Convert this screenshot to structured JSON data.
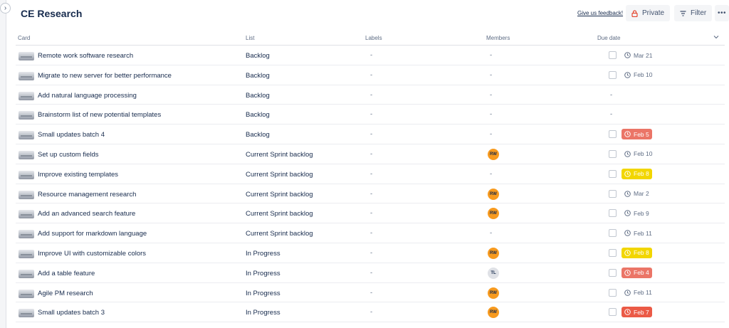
{
  "header": {
    "title": "CE Research",
    "feedback_link": "Give us feedback!",
    "private_label": "Private",
    "filter_label": "Filter",
    "more_label": "•••"
  },
  "columns": {
    "card": "Card",
    "list": "List",
    "labels": "Labels",
    "members": "Members",
    "due_date": "Due date"
  },
  "empty_value": "-",
  "colors": {
    "avatar_rw": "#f79a1f",
    "avatar_tl": "#dfe1e6",
    "due_red_light": "#eb7567",
    "due_yellow": "#f2d600",
    "due_red": "#eb5a46"
  },
  "rows": [
    {
      "card": "Remote work software research",
      "list": "Backlog",
      "labels": "-",
      "member": null,
      "has_checkbox": true,
      "due": "Mar 21",
      "due_status": "plain"
    },
    {
      "card": "Migrate to new server for better performance",
      "list": "Backlog",
      "labels": "-",
      "member": null,
      "has_checkbox": true,
      "due": "Feb 10",
      "due_status": "plain"
    },
    {
      "card": "Add natural language processing",
      "list": "Backlog",
      "labels": "-",
      "member": null,
      "has_checkbox": false,
      "due": null,
      "due_status": "none"
    },
    {
      "card": "Brainstorm list of new potential templates",
      "list": "Backlog",
      "labels": "-",
      "member": null,
      "has_checkbox": false,
      "due": null,
      "due_status": "none"
    },
    {
      "card": "Small updates batch 4",
      "list": "Backlog",
      "labels": "-",
      "member": null,
      "has_checkbox": true,
      "due": "Feb 5",
      "due_status": "overdue"
    },
    {
      "card": "Set up custom fields",
      "list": "Current Sprint backlog",
      "labels": "-",
      "member": "RW",
      "has_checkbox": true,
      "due": "Feb 10",
      "due_status": "plain"
    },
    {
      "card": "Improve existing templates",
      "list": "Current Sprint backlog",
      "labels": "-",
      "member": null,
      "has_checkbox": true,
      "due": "Feb 8",
      "due_status": "soon"
    },
    {
      "card": "Resource management research",
      "list": "Current Sprint backlog",
      "labels": "-",
      "member": "RW",
      "has_checkbox": true,
      "due": "Mar 2",
      "due_status": "plain"
    },
    {
      "card": "Add an advanced search feature",
      "list": "Current Sprint backlog",
      "labels": "-",
      "member": "RW",
      "has_checkbox": true,
      "due": "Feb 9",
      "due_status": "plain"
    },
    {
      "card": "Add support for markdown language",
      "list": "Current Sprint backlog",
      "labels": "-",
      "member": null,
      "has_checkbox": true,
      "due": "Feb 11",
      "due_status": "plain"
    },
    {
      "card": "Improve UI with customizable colors",
      "list": "In Progress",
      "labels": "-",
      "member": "RW",
      "has_checkbox": true,
      "due": "Feb 8",
      "due_status": "soon"
    },
    {
      "card": "Add a table feature",
      "list": "In Progress",
      "labels": "-",
      "member": "TL",
      "has_checkbox": true,
      "due": "Feb 4",
      "due_status": "overdue"
    },
    {
      "card": "Agile PM research",
      "list": "In Progress",
      "labels": "-",
      "member": "RW",
      "has_checkbox": true,
      "due": "Feb 11",
      "due_status": "plain"
    },
    {
      "card": "Small updates batch 3",
      "list": "In Progress",
      "labels": "-",
      "member": "RW",
      "has_checkbox": true,
      "due": "Feb 7",
      "due_status": "overdue-strong"
    }
  ]
}
